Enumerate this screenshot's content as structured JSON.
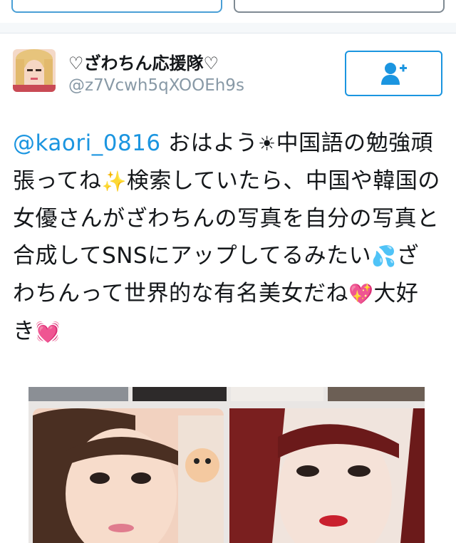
{
  "tweet": {
    "display_name": "♡ざわちん応援隊♡",
    "handle": "@z7Vcwh5qXOOEh9s",
    "mention": "@kaori_0816",
    "text_part1": " おはよう",
    "emoji_sun": "☀",
    "text_part2": "中国語の勉強頑張ってね",
    "emoji_sparkles": "✨",
    "text_part3": "検索していたら、中国や韓国の女優さんがざわちんの写真を自分の写真と合成してSNSにアップしてるみたい",
    "emoji_sweat": "💦",
    "text_part4": "ざわちんって世界的な有名美女だね",
    "emoji_heart1": "💖",
    "text_part5": "大好き",
    "emoji_heart2": "💓"
  },
  "icons": {
    "follow": "add-user-icon",
    "avatar": "profile-photo"
  },
  "colors": {
    "link": "#1b95e0",
    "muted": "#8899a6",
    "text": "#14171a"
  }
}
